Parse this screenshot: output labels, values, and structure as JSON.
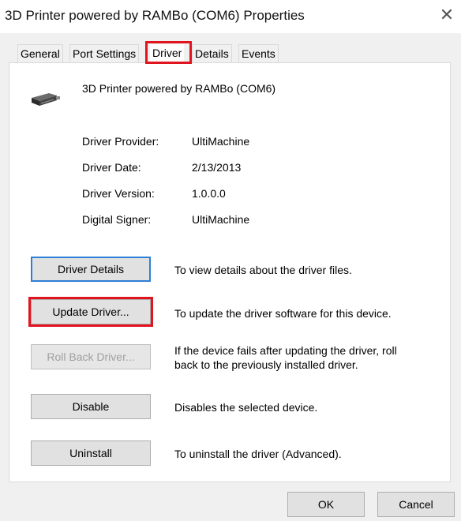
{
  "window": {
    "title": "3D Printer powered by RAMBo (COM6) Properties",
    "close_glyph": "✕"
  },
  "tabs": [
    {
      "label": "General"
    },
    {
      "label": "Port Settings"
    },
    {
      "label": "Driver",
      "selected": true
    },
    {
      "label": "Details"
    },
    {
      "label": "Events"
    }
  ],
  "device": {
    "name": "3D Printer powered by RAMBo (COM6)",
    "icon": "printer-icon"
  },
  "properties": [
    {
      "label": "Driver Provider:",
      "value": "UltiMachine"
    },
    {
      "label": "Driver Date:",
      "value": "2/13/2013"
    },
    {
      "label": "Driver Version:",
      "value": "1.0.0.0"
    },
    {
      "label": "Digital Signer:",
      "value": "UltiMachine"
    }
  ],
  "actions": [
    {
      "button": "Driver Details",
      "description": "To view details about the driver files."
    },
    {
      "button": "Update Driver...",
      "description": "To update the driver software for this device."
    },
    {
      "button": "Roll Back Driver...",
      "description": "If the device fails after updating the driver, roll back to the previously installed driver.",
      "description_line1": "If the device fails after updating the driver, roll",
      "description_line2": "back to the previously installed driver.",
      "disabled": true
    },
    {
      "button": "Disable",
      "description": "Disables the selected device."
    },
    {
      "button": "Uninstall",
      "description": "To uninstall the driver (Advanced)."
    }
  ],
  "footer": {
    "ok": "OK",
    "cancel": "Cancel"
  },
  "colors": {
    "highlight": "#e0141f",
    "default_button_border": "#2f7fd7",
    "dialog_background": "#f0f0f0"
  }
}
